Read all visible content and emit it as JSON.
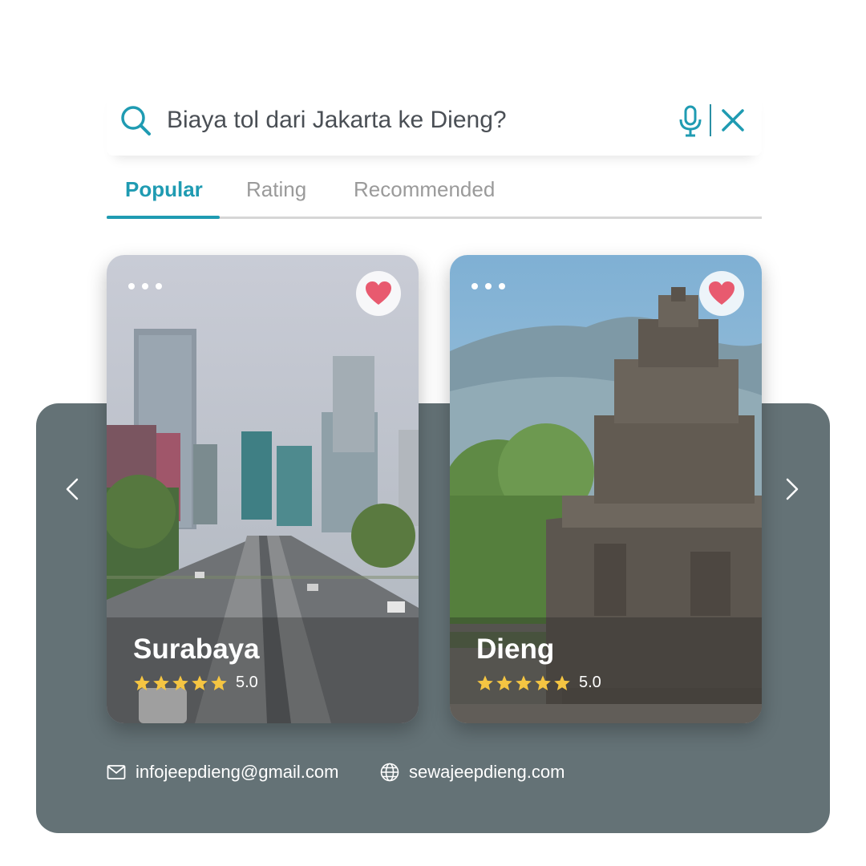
{
  "search": {
    "query": "Biaya tol dari Jakarta ke Dieng?",
    "icon": "search-icon",
    "mic_icon": "microphone-icon",
    "clear_icon": "close-icon"
  },
  "tabs": [
    {
      "label": "Popular",
      "active": true
    },
    {
      "label": "Rating",
      "active": false
    },
    {
      "label": "Recommended",
      "active": false
    }
  ],
  "cards": [
    {
      "name": "Surabaya",
      "rating": "5.0",
      "stars": 5,
      "favorited": true,
      "image": "city-highway-skyscrapers"
    },
    {
      "name": "Dieng",
      "rating": "5.0",
      "stars": 5,
      "favorited": true,
      "image": "stone-temple-misty-hills"
    }
  ],
  "carousel": {
    "prev_icon": "chevron-left-icon",
    "next_icon": "chevron-right-icon"
  },
  "footer": {
    "email": "infojeepdieng@gmail.com",
    "website": "sewajeepdieng.com"
  },
  "colors": {
    "accent": "#1f9bb2",
    "panel": "#647276",
    "heart": "#e85a6f",
    "star": "#f5c542"
  }
}
